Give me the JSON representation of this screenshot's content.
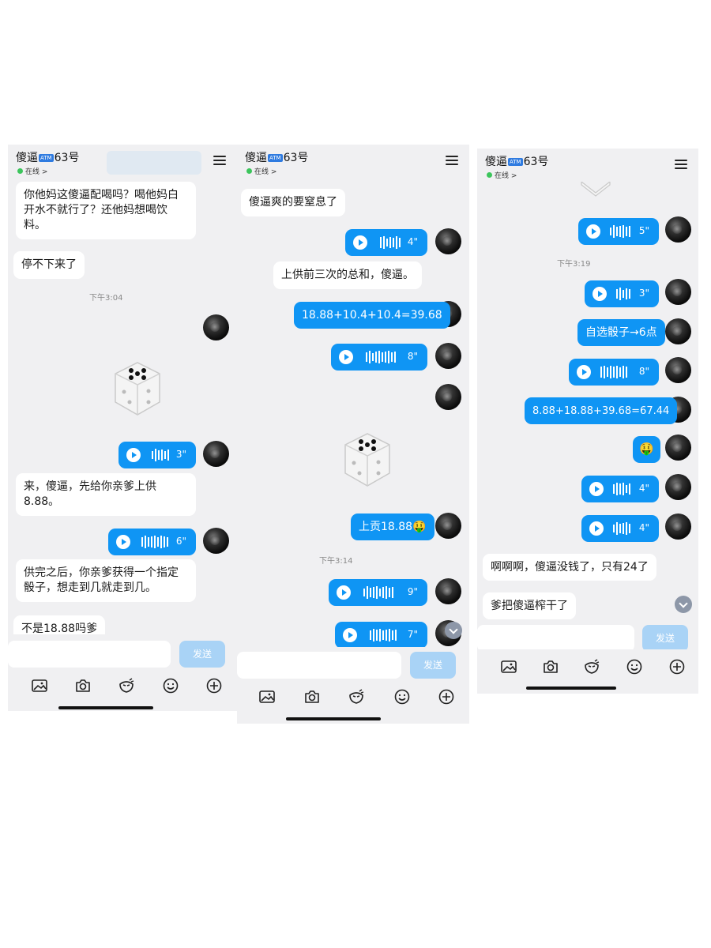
{
  "panels": [
    {
      "title_prefix": "傻逼",
      "title_badge": "ATM",
      "title_suffix": "63号",
      "status": "在线 >",
      "messages": {
        "m1": "你他妈这傻逼配喝吗？喝他妈白开水不就行了？还他妈想喝饮料。",
        "m2": "停不下来了",
        "ts1": "下午3:04",
        "v1": "3\"",
        "m3": "来，傻逼，先给你亲爹上供8.88。",
        "v2": "6\"",
        "m4": "供完之后，你亲爹获得一个指定骰子，想走到几就走到几。",
        "m5": "不是18.88吗爹"
      },
      "send_label": "发送"
    },
    {
      "title_prefix": "傻逼",
      "title_badge": "ATM",
      "title_suffix": "63号",
      "status": "在线 >",
      "messages": {
        "m1": "傻逼爽的要窒息了",
        "v1": "4\"",
        "m2": "上供前三次的总和，傻逼。",
        "m3": "18.88+10.4+10.4=39.68",
        "v2": "8\"",
        "m4": "上贡18.88🤑",
        "ts1": "下午3:14",
        "v3": "9\"",
        "v4": "7\""
      },
      "send_label": "发送"
    },
    {
      "title_prefix": "傻逼",
      "title_badge": "ATM",
      "title_suffix": "63号",
      "status": "在线 >",
      "messages": {
        "v1": "5\"",
        "ts1": "下午3:19",
        "v2": "3\"",
        "m1": "自选骰子→6点",
        "v3": "8\"",
        "m2": "8.88+18.88+39.68=67.44",
        "m3": "🤑",
        "v4": "4\"",
        "v5": "4\"",
        "m4": "啊啊啊，傻逼没钱了，只有24了",
        "m5": "爹把傻逼榨干了"
      },
      "send_label": "发送"
    }
  ],
  "toolbar_icons": [
    "image-icon",
    "camera-icon",
    "sticker-icon",
    "emoji-icon",
    "plus-icon"
  ],
  "colors": {
    "bubble_out": "#0f95f4",
    "bubble_in": "#ffffff",
    "background": "#f0f0f2",
    "send_disabled": "#a9d3f6"
  }
}
